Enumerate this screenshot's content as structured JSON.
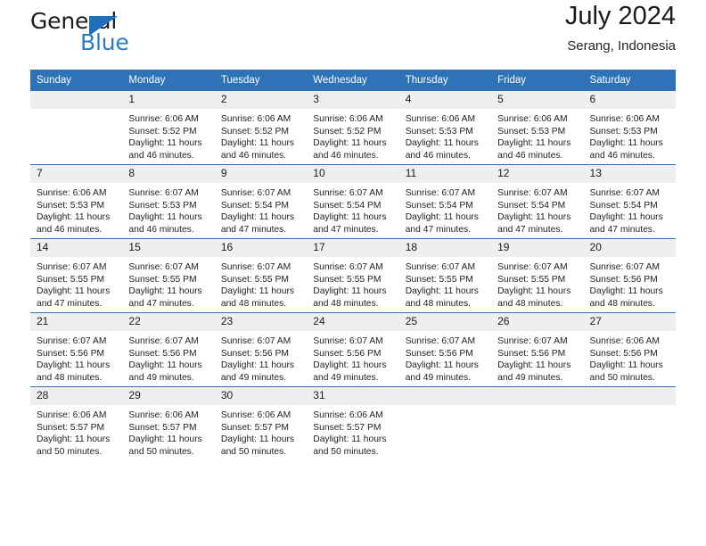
{
  "logo": {
    "word1": "General",
    "word2": "Blue",
    "triangle_color": "#1c6fb8",
    "word2_color": "#2b7cc4"
  },
  "header": {
    "title": "July 2024",
    "subtitle": "Serang, Indonesia",
    "accent_color": "#2e72b8"
  },
  "calendar": {
    "weekday_headers": [
      "Sunday",
      "Monday",
      "Tuesday",
      "Wednesday",
      "Thursday",
      "Friday",
      "Saturday"
    ],
    "weeks": [
      [
        {
          "day": "",
          "sunrise": "",
          "sunset": "",
          "daylight1": "",
          "daylight2": ""
        },
        {
          "day": "1",
          "sunrise": "Sunrise: 6:06 AM",
          "sunset": "Sunset: 5:52 PM",
          "daylight1": "Daylight: 11 hours",
          "daylight2": "and 46 minutes."
        },
        {
          "day": "2",
          "sunrise": "Sunrise: 6:06 AM",
          "sunset": "Sunset: 5:52 PM",
          "daylight1": "Daylight: 11 hours",
          "daylight2": "and 46 minutes."
        },
        {
          "day": "3",
          "sunrise": "Sunrise: 6:06 AM",
          "sunset": "Sunset: 5:52 PM",
          "daylight1": "Daylight: 11 hours",
          "daylight2": "and 46 minutes."
        },
        {
          "day": "4",
          "sunrise": "Sunrise: 6:06 AM",
          "sunset": "Sunset: 5:53 PM",
          "daylight1": "Daylight: 11 hours",
          "daylight2": "and 46 minutes."
        },
        {
          "day": "5",
          "sunrise": "Sunrise: 6:06 AM",
          "sunset": "Sunset: 5:53 PM",
          "daylight1": "Daylight: 11 hours",
          "daylight2": "and 46 minutes."
        },
        {
          "day": "6",
          "sunrise": "Sunrise: 6:06 AM",
          "sunset": "Sunset: 5:53 PM",
          "daylight1": "Daylight: 11 hours",
          "daylight2": "and 46 minutes."
        }
      ],
      [
        {
          "day": "7",
          "sunrise": "Sunrise: 6:06 AM",
          "sunset": "Sunset: 5:53 PM",
          "daylight1": "Daylight: 11 hours",
          "daylight2": "and 46 minutes."
        },
        {
          "day": "8",
          "sunrise": "Sunrise: 6:07 AM",
          "sunset": "Sunset: 5:53 PM",
          "daylight1": "Daylight: 11 hours",
          "daylight2": "and 46 minutes."
        },
        {
          "day": "9",
          "sunrise": "Sunrise: 6:07 AM",
          "sunset": "Sunset: 5:54 PM",
          "daylight1": "Daylight: 11 hours",
          "daylight2": "and 47 minutes."
        },
        {
          "day": "10",
          "sunrise": "Sunrise: 6:07 AM",
          "sunset": "Sunset: 5:54 PM",
          "daylight1": "Daylight: 11 hours",
          "daylight2": "and 47 minutes."
        },
        {
          "day": "11",
          "sunrise": "Sunrise: 6:07 AM",
          "sunset": "Sunset: 5:54 PM",
          "daylight1": "Daylight: 11 hours",
          "daylight2": "and 47 minutes."
        },
        {
          "day": "12",
          "sunrise": "Sunrise: 6:07 AM",
          "sunset": "Sunset: 5:54 PM",
          "daylight1": "Daylight: 11 hours",
          "daylight2": "and 47 minutes."
        },
        {
          "day": "13",
          "sunrise": "Sunrise: 6:07 AM",
          "sunset": "Sunset: 5:54 PM",
          "daylight1": "Daylight: 11 hours",
          "daylight2": "and 47 minutes."
        }
      ],
      [
        {
          "day": "14",
          "sunrise": "Sunrise: 6:07 AM",
          "sunset": "Sunset: 5:55 PM",
          "daylight1": "Daylight: 11 hours",
          "daylight2": "and 47 minutes."
        },
        {
          "day": "15",
          "sunrise": "Sunrise: 6:07 AM",
          "sunset": "Sunset: 5:55 PM",
          "daylight1": "Daylight: 11 hours",
          "daylight2": "and 47 minutes."
        },
        {
          "day": "16",
          "sunrise": "Sunrise: 6:07 AM",
          "sunset": "Sunset: 5:55 PM",
          "daylight1": "Daylight: 11 hours",
          "daylight2": "and 48 minutes."
        },
        {
          "day": "17",
          "sunrise": "Sunrise: 6:07 AM",
          "sunset": "Sunset: 5:55 PM",
          "daylight1": "Daylight: 11 hours",
          "daylight2": "and 48 minutes."
        },
        {
          "day": "18",
          "sunrise": "Sunrise: 6:07 AM",
          "sunset": "Sunset: 5:55 PM",
          "daylight1": "Daylight: 11 hours",
          "daylight2": "and 48 minutes."
        },
        {
          "day": "19",
          "sunrise": "Sunrise: 6:07 AM",
          "sunset": "Sunset: 5:55 PM",
          "daylight1": "Daylight: 11 hours",
          "daylight2": "and 48 minutes."
        },
        {
          "day": "20",
          "sunrise": "Sunrise: 6:07 AM",
          "sunset": "Sunset: 5:56 PM",
          "daylight1": "Daylight: 11 hours",
          "daylight2": "and 48 minutes."
        }
      ],
      [
        {
          "day": "21",
          "sunrise": "Sunrise: 6:07 AM",
          "sunset": "Sunset: 5:56 PM",
          "daylight1": "Daylight: 11 hours",
          "daylight2": "and 48 minutes."
        },
        {
          "day": "22",
          "sunrise": "Sunrise: 6:07 AM",
          "sunset": "Sunset: 5:56 PM",
          "daylight1": "Daylight: 11 hours",
          "daylight2": "and 49 minutes."
        },
        {
          "day": "23",
          "sunrise": "Sunrise: 6:07 AM",
          "sunset": "Sunset: 5:56 PM",
          "daylight1": "Daylight: 11 hours",
          "daylight2": "and 49 minutes."
        },
        {
          "day": "24",
          "sunrise": "Sunrise: 6:07 AM",
          "sunset": "Sunset: 5:56 PM",
          "daylight1": "Daylight: 11 hours",
          "daylight2": "and 49 minutes."
        },
        {
          "day": "25",
          "sunrise": "Sunrise: 6:07 AM",
          "sunset": "Sunset: 5:56 PM",
          "daylight1": "Daylight: 11 hours",
          "daylight2": "and 49 minutes."
        },
        {
          "day": "26",
          "sunrise": "Sunrise: 6:07 AM",
          "sunset": "Sunset: 5:56 PM",
          "daylight1": "Daylight: 11 hours",
          "daylight2": "and 49 minutes."
        },
        {
          "day": "27",
          "sunrise": "Sunrise: 6:06 AM",
          "sunset": "Sunset: 5:56 PM",
          "daylight1": "Daylight: 11 hours",
          "daylight2": "and 50 minutes."
        }
      ],
      [
        {
          "day": "28",
          "sunrise": "Sunrise: 6:06 AM",
          "sunset": "Sunset: 5:57 PM",
          "daylight1": "Daylight: 11 hours",
          "daylight2": "and 50 minutes."
        },
        {
          "day": "29",
          "sunrise": "Sunrise: 6:06 AM",
          "sunset": "Sunset: 5:57 PM",
          "daylight1": "Daylight: 11 hours",
          "daylight2": "and 50 minutes."
        },
        {
          "day": "30",
          "sunrise": "Sunrise: 6:06 AM",
          "sunset": "Sunset: 5:57 PM",
          "daylight1": "Daylight: 11 hours",
          "daylight2": "and 50 minutes."
        },
        {
          "day": "31",
          "sunrise": "Sunrise: 6:06 AM",
          "sunset": "Sunset: 5:57 PM",
          "daylight1": "Daylight: 11 hours",
          "daylight2": "and 50 minutes."
        },
        {
          "day": "",
          "sunrise": "",
          "sunset": "",
          "daylight1": "",
          "daylight2": ""
        },
        {
          "day": "",
          "sunrise": "",
          "sunset": "",
          "daylight1": "",
          "daylight2": ""
        },
        {
          "day": "",
          "sunrise": "",
          "sunset": "",
          "daylight1": "",
          "daylight2": ""
        }
      ]
    ]
  }
}
